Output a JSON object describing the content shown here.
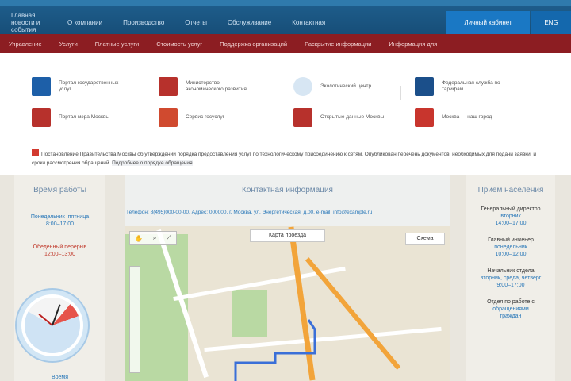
{
  "topnav": {
    "items": [
      "Главная, новости и события",
      "О компании",
      "Производство",
      "Отчеты",
      "Обслуживание",
      "Контактная"
    ],
    "login": "Личный кабинет",
    "lang": "ENG"
  },
  "rednav": {
    "items": [
      "Управление",
      "Услуги",
      "Платные услуги",
      "Стоимость услуг",
      "Поддержка организаций",
      "Раскрытие информации",
      "Информация для"
    ]
  },
  "partners": [
    {
      "text": "Портал государственных услуг",
      "color": "#1d5fa8"
    },
    {
      "text": "Министерство экономического развития",
      "color": "#b7312c"
    },
    {
      "text": "Экологический центр",
      "color": "#d7e6f3"
    },
    {
      "text": "Федеральная служба по тарифам",
      "color": "#1b4f8a"
    },
    {
      "text": "Портал мэра Москвы",
      "color": "#b7312c"
    },
    {
      "text": "Сервис госуслуг",
      "color": "#d04a2f"
    },
    {
      "text": "Открытые данные Москвы",
      "color": "#b7312c"
    },
    {
      "text": "Москва — наш город",
      "color": "#c8352d"
    }
  ],
  "notice": {
    "text": "Постановление Правительства Москвы об утверждении порядка предоставления услуг по технологическому присоединению к сетям. Опубликован перечень документов, необходимых для подачи заявки, и сроки рассмотрения обращений.",
    "link": "Подробнее о порядке обращения"
  },
  "left": {
    "title": "Время работы",
    "lines": [
      {
        "a": "Понедельник–пятница",
        "b": "8:00–17:00"
      },
      {
        "a": "Обеденный перерыв",
        "b": "12:00–13:00"
      }
    ],
    "footer": "Время"
  },
  "middle": {
    "title": "Контактная информация",
    "contact": "Телефон: 8(495)000-00-00, Адрес: 000000, г. Москва, ул. Энергетическая, д.00, e-mail: info@example.ru",
    "map_title": "Карта проезда",
    "map_button": "Схема"
  },
  "right": {
    "title": "Приём населения",
    "blocks": [
      {
        "a": "Генеральный директор",
        "b": "вторник",
        "c": "14:00–17:00"
      },
      {
        "a": "Главный инженер",
        "b": "понедельник",
        "c": "10:00–12:00"
      },
      {
        "a": "Начальник отдела",
        "b": "вторник, среда, четверг",
        "c": "9:00–17:00"
      },
      {
        "a": "Отдел по работе с",
        "b": "обращениями",
        "c": "граждан"
      }
    ]
  }
}
